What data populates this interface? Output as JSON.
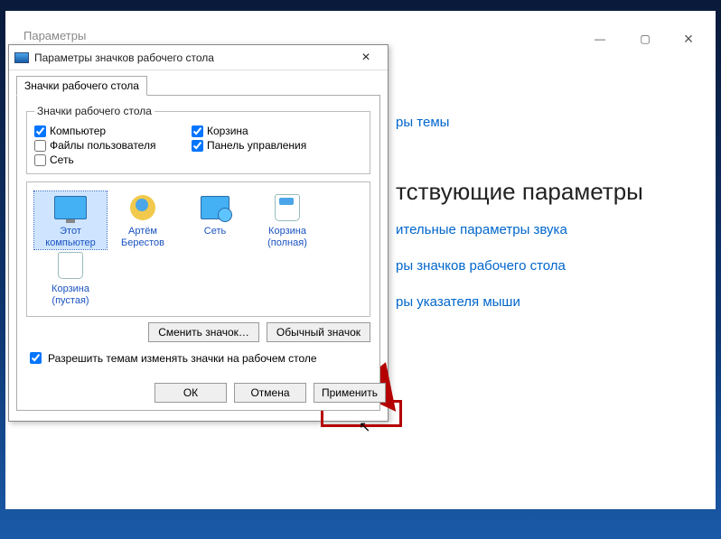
{
  "settings": {
    "title": "Параметры",
    "links": {
      "l1": "ры темы",
      "heading": "тствующие параметры",
      "l2": "ительные параметры звука",
      "l3": "ры значков рабочего стола",
      "l4": "ры указателя мыши"
    }
  },
  "dialog": {
    "title": "Параметры значков рабочего стола",
    "tab": "Значки рабочего стола",
    "group_title": "Значки рабочего стола",
    "checks": {
      "computer": "Компьютер",
      "recycle": "Корзина",
      "userfiles": "Файлы пользователя",
      "cpanel": "Панель управления",
      "network": "Сеть"
    },
    "icons": {
      "this_pc": "Этот\nкомпьютер",
      "user": "Артём\nБерестов",
      "network": "Сеть",
      "bin_full": "Корзина\n(полная)",
      "bin_empty": "Корзина\n(пустая)"
    },
    "buttons": {
      "change": "Сменить значок…",
      "default": "Обычный значок"
    },
    "allow_theme": "Разрешить темам изменять значки на рабочем столе",
    "footer": {
      "ok": "ОК",
      "cancel": "Отмена",
      "apply": "Применить"
    }
  }
}
